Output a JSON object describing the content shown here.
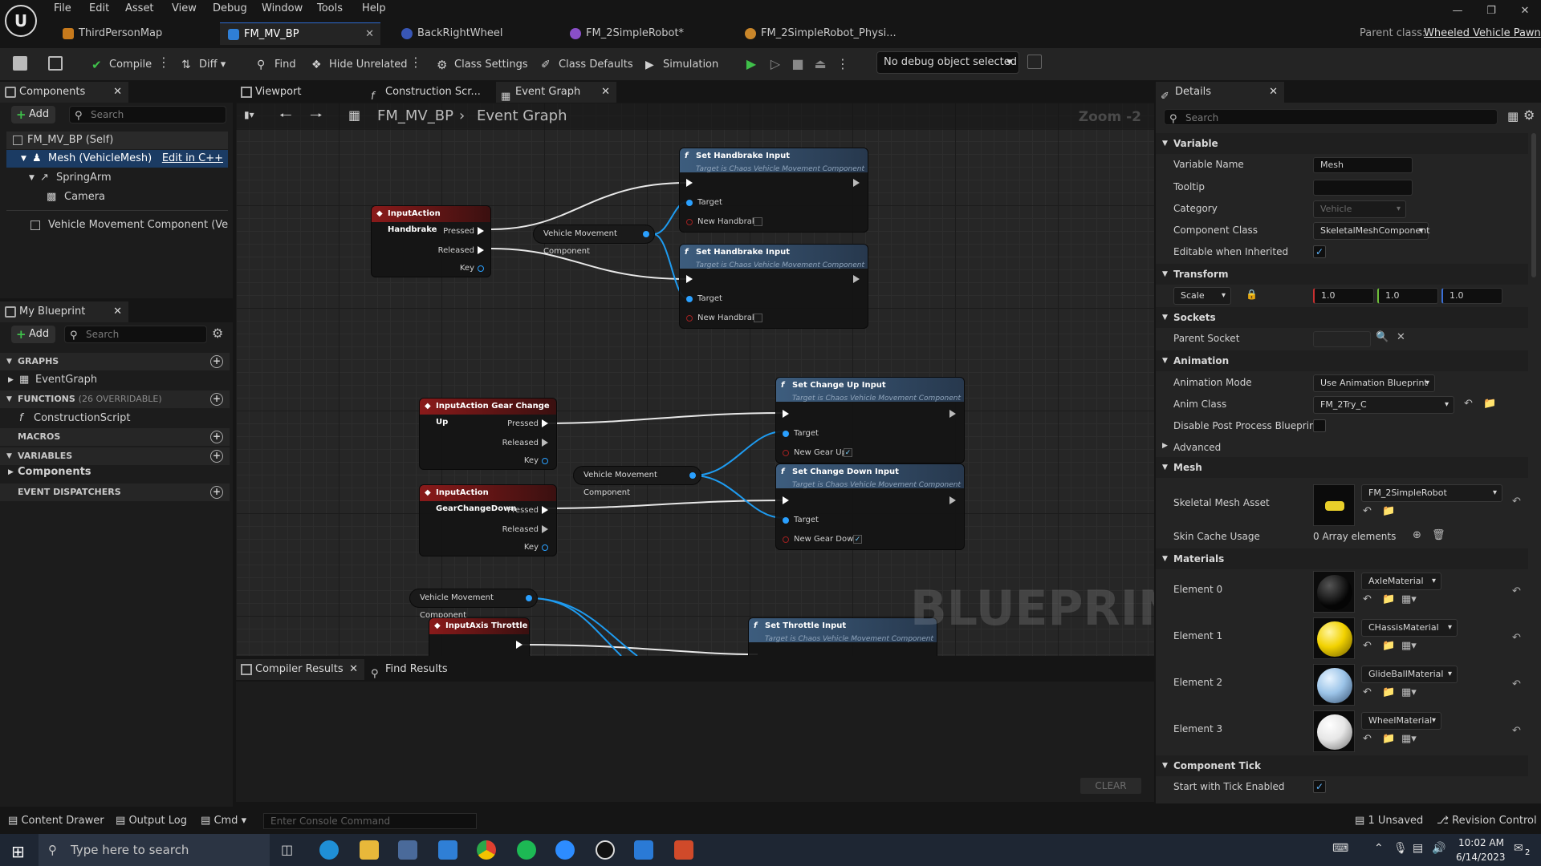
{
  "menu": [
    "File",
    "Edit",
    "Asset",
    "View",
    "Debug",
    "Window",
    "Tools",
    "Help"
  ],
  "tabs": [
    {
      "label": "ThirdPersonMap"
    },
    {
      "label": "FM_MV_BP"
    },
    {
      "label": "BackRightWheel"
    },
    {
      "label": "FM_2SimpleRobot*"
    },
    {
      "label": "FM_2SimpleRobot_Physi..."
    }
  ],
  "parent_class": {
    "label": "Parent class:",
    "value": "Wheeled Vehicle Pawn"
  },
  "toolbar": {
    "compile": "Compile",
    "diff": "Diff",
    "find": "Find",
    "hide_unrelated": "Hide Unrelated",
    "class_settings": "Class Settings",
    "class_defaults": "Class Defaults",
    "simulation": "Simulation",
    "debug_object": "No debug object selected"
  },
  "components": {
    "title": "Components",
    "add": "Add",
    "search_placeholder": "Search",
    "items": [
      {
        "label": "FM_MV_BP (Self)"
      },
      {
        "label": "Mesh (VehicleMesh)",
        "action": "Edit in C++"
      },
      {
        "label": "SpringArm"
      },
      {
        "label": "Camera"
      },
      {
        "label": "Vehicle Movement Component (VehicleI"
      }
    ]
  },
  "my_blueprint": {
    "title": "My Blueprint",
    "add": "Add",
    "search_placeholder": "Search",
    "sections": {
      "graphs": "GRAPHS",
      "event_graph": "EventGraph",
      "functions": "FUNCTIONS",
      "functions_count": "(26 OVERRIDABLE)",
      "construction_script": "ConstructionScript",
      "macros": "MACROS",
      "variables": "VARIABLES",
      "components": "Components",
      "event_dispatchers": "EVENT DISPATCHERS"
    }
  },
  "editor_tabs": {
    "viewport": "Viewport",
    "construction": "Construction Scr...",
    "event_graph": "Event Graph"
  },
  "breadcrumb": {
    "blueprint": "FM_MV_BP",
    "graph": "Event Graph",
    "zoom": "Zoom -2"
  },
  "graph": {
    "watermark": "BLUEPRINT",
    "nodes": {
      "ia_handbrake": {
        "title": "InputAction Handbrake",
        "pressed": "Pressed",
        "released": "Released",
        "key": "Key"
      },
      "vmc1": "Vehicle Movement Component",
      "set_hb1": {
        "title": "Set Handbrake Input",
        "sub": "Target is Chaos Vehicle Movement Component",
        "target": "Target",
        "param": "New Handbrake"
      },
      "set_hb2": {
        "title": "Set Handbrake Input",
        "sub": "Target is Chaos Vehicle Movement Component",
        "target": "Target",
        "param": "New Handbrake"
      },
      "ia_gearup": {
        "title": "InputAction Gear Change Up",
        "pressed": "Pressed",
        "released": "Released",
        "key": "Key"
      },
      "ia_geardown": {
        "title": "InputAction GearChangeDown",
        "pressed": "Pressed",
        "released": "Released",
        "key": "Key"
      },
      "vmc2": "Vehicle Movement Component",
      "set_up": {
        "title": "Set Change Up Input",
        "sub": "Target is Chaos Vehicle Movement Component",
        "target": "Target",
        "param": "New Gear Up"
      },
      "set_down": {
        "title": "Set Change Down Input",
        "sub": "Target is Chaos Vehicle Movement Component",
        "target": "Target",
        "param": "New Gear Down"
      },
      "vmc3": "Vehicle Movement Component",
      "ia_throttle": {
        "title": "InputAxis Throttle"
      },
      "set_throttle": {
        "title": "Set Throttle Input",
        "sub": "Target is Chaos Vehicle Movement Component"
      }
    }
  },
  "details": {
    "title": "Details",
    "search_placeholder": "Search",
    "variable": {
      "section": "Variable",
      "name_label": "Variable Name",
      "name_value": "Mesh",
      "tooltip_label": "Tooltip",
      "category_label": "Category",
      "category_value": "Vehicle",
      "component_class_label": "Component Class",
      "component_class_value": "SkeletalMeshComponent",
      "editable_label": "Editable when Inherited"
    },
    "transform": {
      "section": "Transform",
      "scale_label": "Scale",
      "x": "1.0",
      "y": "1.0",
      "z": "1.0"
    },
    "sockets": {
      "section": "Sockets",
      "parent_socket_label": "Parent Socket"
    },
    "animation": {
      "section": "Animation",
      "mode_label": "Animation Mode",
      "mode_value": "Use Animation Blueprint",
      "class_label": "Anim Class",
      "class_value": "FM_2Try_C",
      "disable_pp_label": "Disable Post Process Blueprint",
      "advanced": "Advanced"
    },
    "mesh": {
      "section": "Mesh",
      "asset_label": "Skeletal Mesh Asset",
      "asset_value": "FM_2SimpleRobot",
      "skin_cache_label": "Skin Cache Usage",
      "skin_cache_value": "0 Array elements"
    },
    "materials": {
      "section": "Materials",
      "elements": [
        {
          "label": "Element 0",
          "value": "AxleMaterial",
          "color": "#111111"
        },
        {
          "label": "Element 1",
          "value": "CHassisMaterial",
          "color": "#f2d200"
        },
        {
          "label": "Element 2",
          "value": "GlideBallMaterial",
          "color": "#9cc4e8"
        },
        {
          "label": "Element 3",
          "value": "WheelMaterial",
          "color": "#e6e6e6"
        }
      ]
    },
    "component_tick": {
      "section": "Component Tick",
      "start_label": "Start with Tick Enabled"
    }
  },
  "bottom": {
    "compiler_results": "Compiler Results",
    "find_results": "Find Results",
    "clear": "CLEAR"
  },
  "status": {
    "content_drawer": "Content Drawer",
    "output_log": "Output Log",
    "cmd": "Cmd",
    "console_placeholder": "Enter Console Command",
    "unsaved": "1 Unsaved",
    "revision": "Revision Control"
  },
  "taskbar": {
    "search_placeholder": "Type here to search",
    "time": "10:02 AM",
    "date": "6/14/2023",
    "notif": "2"
  }
}
